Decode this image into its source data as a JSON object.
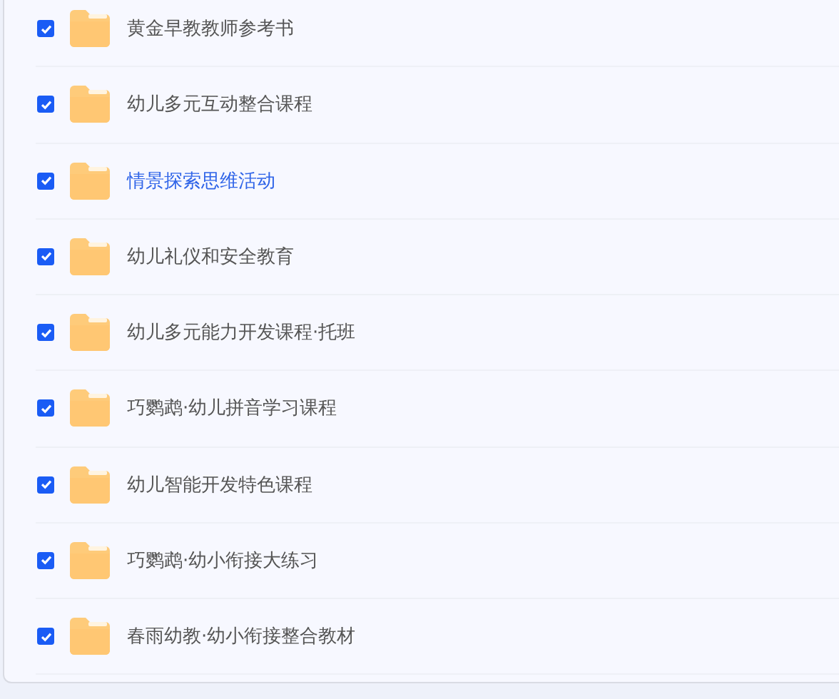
{
  "items": [
    {
      "name": "黄金早教教师参考书",
      "checked": true,
      "highlighted": false
    },
    {
      "name": "幼儿多元互动整合课程",
      "checked": true,
      "highlighted": false
    },
    {
      "name": "情景探索思维活动",
      "checked": true,
      "highlighted": true
    },
    {
      "name": "幼儿礼仪和安全教育",
      "checked": true,
      "highlighted": false
    },
    {
      "name": "幼儿多元能力开发课程·托班",
      "checked": true,
      "highlighted": false
    },
    {
      "name": "巧鹦鹉·幼儿拼音学习课程",
      "checked": true,
      "highlighted": false
    },
    {
      "name": "幼儿智能开发特色课程",
      "checked": true,
      "highlighted": false
    },
    {
      "name": "巧鹦鹉·幼小衔接大练习",
      "checked": true,
      "highlighted": false
    },
    {
      "name": "春雨幼教·幼小衔接整合教材",
      "checked": true,
      "highlighted": false
    }
  ]
}
